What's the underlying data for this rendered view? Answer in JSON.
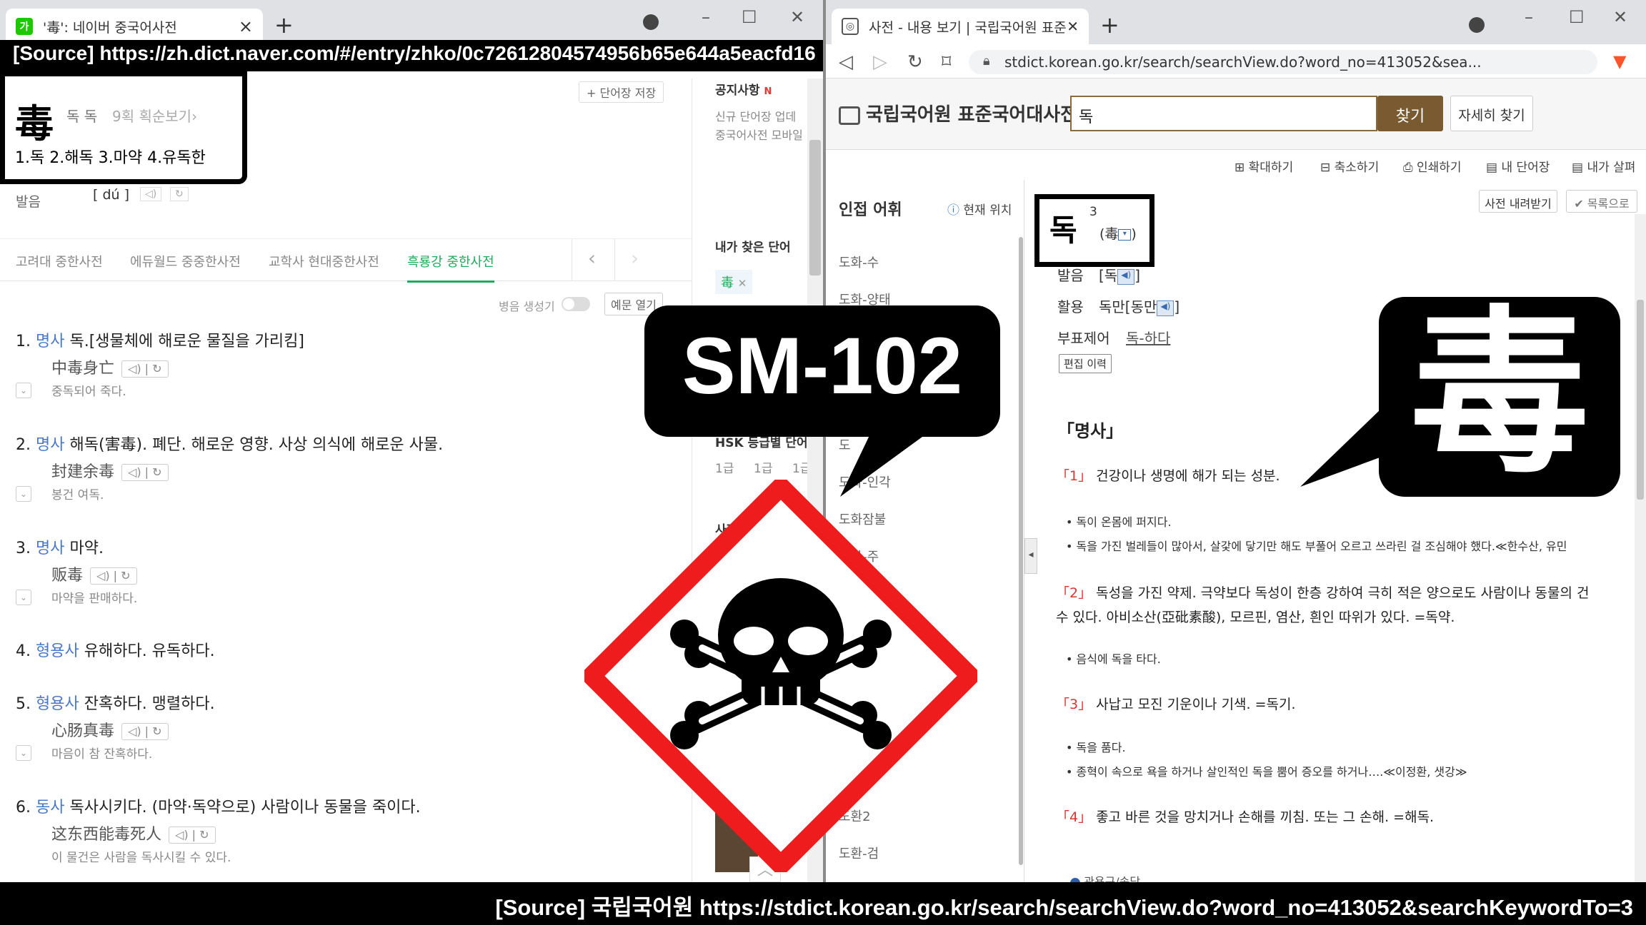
{
  "left_browser": {
    "tab_title": "'毒': 네이버 중국어사전",
    "tab_close": "×",
    "new_tab": "+",
    "win_min": "–",
    "win_max": "☐",
    "win_close": "✕"
  },
  "source_top": "[Source] https://zh.dict.naver.com/#/entry/zhko/0c72612804574956b65e644a5eacfd16",
  "headword": {
    "char": "毒",
    "reading": "독 독",
    "strokes": "9획 획순보기",
    "meanings": "1.독 2.해독 3.마약 4.유독한"
  },
  "save_wordbook": "+ 단어장 저장",
  "pronunciation": {
    "label": "발음",
    "pinyin": "[ dú ]"
  },
  "dict_tabs": [
    "고려대 중한사전",
    "에듀월드 중중한사전",
    "교학사 현대중한사전",
    "흑룡강 중한사전"
  ],
  "pinyin_toggle": "병음 생성기",
  "example_open": "예문 열기",
  "entries": [
    {
      "num": "1.",
      "pos": "명사",
      "def": "독.[생물체에 해로운 물질을 가리킴]",
      "ex_zh": "中毒身亡",
      "ex_ko": "중독되어 죽다."
    },
    {
      "num": "2.",
      "pos": "명사",
      "def": "해독(害毒). 폐단. 해로운 영향. 사상 의식에 해로운 사물.",
      "ex_zh": "封建余毒",
      "ex_ko": "봉건 여독."
    },
    {
      "num": "3.",
      "pos": "명사",
      "def": "마약.",
      "ex_zh": "贩毒",
      "ex_ko": "마약을 판매하다."
    },
    {
      "num": "4.",
      "pos": "형용사",
      "def": "유해하다. 유독하다.",
      "ex_zh": "",
      "ex_ko": ""
    },
    {
      "num": "5.",
      "pos": "형용사",
      "def": "잔혹하다. 맹렬하다.",
      "ex_zh": "心肠真毒",
      "ex_ko": "마음이 참 잔혹하다."
    },
    {
      "num": "6.",
      "pos": "동사",
      "def": "독사시키다. (마약·독약으로) 사람이나 동물을 죽이다.",
      "ex_zh": "这东西能毒死人",
      "ex_ko": "이 물건은 사람을 독사시킬 수 있다."
    }
  ],
  "side_panel": {
    "notice_title": "공지사항",
    "notice_new": "N",
    "notice_line1": "신규 단어장 업데",
    "notice_line2": "중국어사전 모바일",
    "found_words": "내가 찾은 단어",
    "found_chip": "毒",
    "hsk_title": "HSK 등급별 단어",
    "hsk_levels": [
      "1급",
      "1급",
      "1급"
    ],
    "dict_label": "사전"
  },
  "right_browser": {
    "tab_title": "사전 - 내용 보기 | 국립국어원 표준",
    "tab_close": "✕",
    "new_tab": "+",
    "url": "stdict.korean.go.kr/search/searchView.do?word_no=413052&sea...",
    "win_min": "–",
    "win_max": "☐",
    "win_close": "✕"
  },
  "stdict": {
    "logo": "국립국어원 표준국어대사전",
    "search_value": "독",
    "search_btn": "찾기",
    "detail_btn": "자세히 찾기",
    "tools": [
      "확대하기",
      "축소하기",
      "인쇄하기",
      "내 단어장",
      "내가 살펴"
    ],
    "nearby_title": "인접 어휘",
    "current_pos": "현재 위치",
    "nearby_words": [
      "도화-수",
      "도화-양태",
      "도",
      "도화-인각",
      "도화잠불",
      "도화-주",
      "도환2",
      "도환-검"
    ],
    "download_btn": "사전 내려받기",
    "list_btn": "✔ 목록으로",
    "entry_word": "독",
    "entry_sup": "3",
    "entry_hanja": "(毒",
    "pron_label": "발음",
    "pron_value": "[독",
    "conj_label": "활용",
    "conj_value": "독만[동만",
    "deriv_label": "부표제어",
    "deriv_value": "독-하다",
    "edit_history": "편집 이력",
    "pos_heading": "「명사」",
    "senses": [
      {
        "num": "「1」",
        "text": "건강이나 생명에 해가 되는 성분.",
        "examples": [
          "독이 온몸에 퍼지다.",
          "독을 가진 벌레들이 많아서, 살갗에 닿기만 해도 부풀어 오르고 쓰라린 걸 조심해야 했다.≪한수산, 유민"
        ]
      },
      {
        "num": "「2」",
        "text": "독성을 가진 약제. 극약보다 독성이 한층 강하여 극히 적은 양으로도 사람이나 동물의 건",
        "text2": "수 있다. 아비소산(亞砒素酸), 모르핀, 염산, 흰인 따위가 있다. =독약.",
        "examples": [
          "음식에 독을 타다."
        ]
      },
      {
        "num": "「3」",
        "text": "사납고 모진 기운이나 기색. =독기.",
        "examples": [
          "독을 품다.",
          "종혁이 속으로 욕을 하거나 살인적인 독을 뿜어 증오를 하거나….≪이정환, 샛강≫"
        ]
      },
      {
        "num": "「4」",
        "text": "좋고 바른 것을 망치거나 손해를 끼침. 또는 그 손해. =해독.",
        "examples": []
      }
    ],
    "more_hint": "관용구/속담"
  },
  "overlay": {
    "callout_label": "SM-102",
    "callout_char": "毒",
    "hazard_symbol": "GHS skull and crossbones"
  },
  "source_bottom": "[Source]   국립국어원   https://stdict.korean.go.kr/search/searchView.do?word_no=413052&searchKeywordTo=3"
}
